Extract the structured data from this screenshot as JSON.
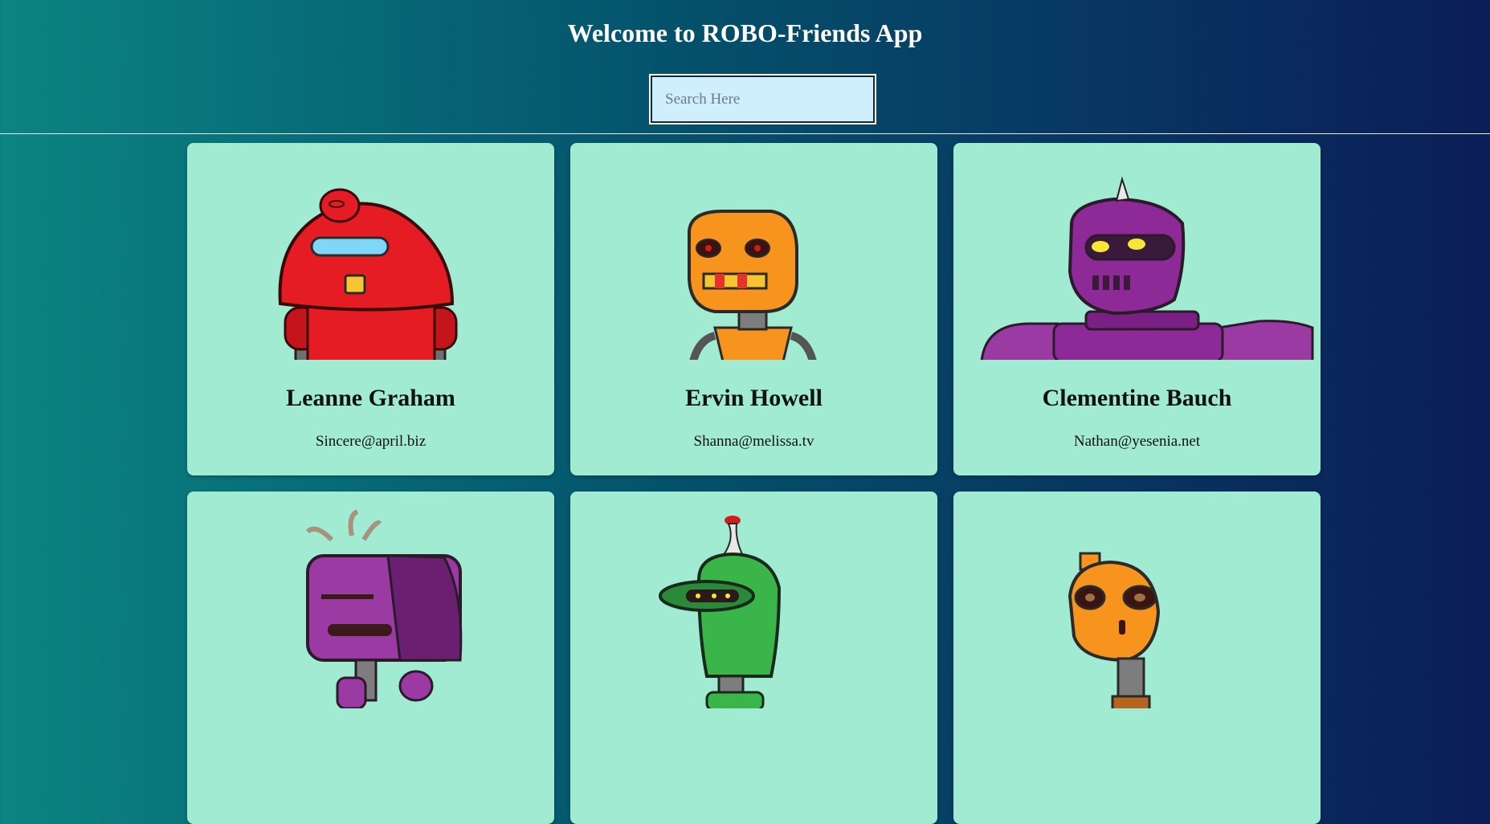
{
  "header": {
    "title": "Welcome to ROBO-Friends App",
    "search_placeholder": "Search Here",
    "search_value": ""
  },
  "colors": {
    "card_background": "#a0ebd2",
    "search_background": "#cfeefe",
    "gradient_start": "#0b8482",
    "gradient_end": "#0b1d58"
  },
  "robots": [
    {
      "name": "Leanne Graham",
      "email": "Sincere@april.biz",
      "image": "red-robot-image"
    },
    {
      "name": "Ervin Howell",
      "email": "Shanna@melissa.tv",
      "image": "orange-robot-image"
    },
    {
      "name": "Clementine Bauch",
      "email": "Nathan@yesenia.net",
      "image": "purple-robot-image"
    },
    {
      "name": "",
      "email": "",
      "image": "purple-boxhead-robot-image"
    },
    {
      "name": "",
      "email": "",
      "image": "green-robot-image"
    },
    {
      "name": "",
      "email": "",
      "image": "orange-roundhead-robot-image"
    }
  ]
}
